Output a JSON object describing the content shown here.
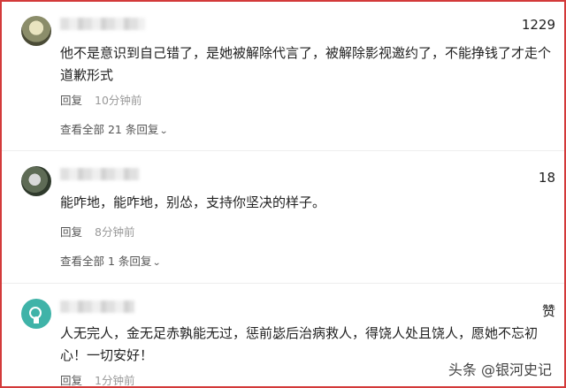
{
  "comments": [
    {
      "likes": "1229",
      "text": "他不是意识到自己错了，是她被解除代言了，被解除影视邀约了，不能挣钱了才走个道歉形式",
      "reply_label": "回复",
      "time": "10分钟前",
      "view_more": "查看全部 21 条回复"
    },
    {
      "likes": "18",
      "text": "能咋地，能咋地，别怂，支持你坚决的样子。",
      "reply_label": "回复",
      "time": "8分钟前",
      "view_more": "查看全部 1 条回复"
    },
    {
      "likes": "赞",
      "text": "人无完人，金无足赤孰能无过，惩前毖后治病救人，得饶人处且饶人，愿她不忘初心！一切安好！",
      "reply_label": "回复",
      "time": "1分钟前"
    }
  ],
  "watermark": "头条 @银河史记",
  "colors": {
    "border": "#d33a3a",
    "avatar3": "#3fb3a8"
  }
}
